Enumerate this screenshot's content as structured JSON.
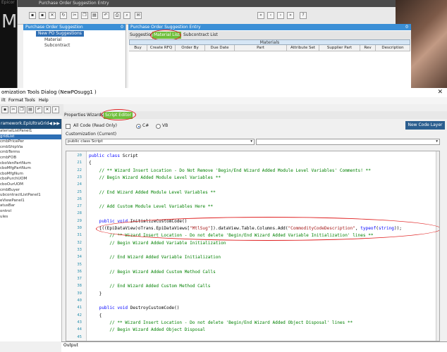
{
  "top_window": {
    "title": "Purchase Order Suggestion Entry",
    "left_title_fragment": "Epicor",
    "left_letter": "M",
    "nav_panel": {
      "header": "Purchase Order Suggestion",
      "header_count": "0",
      "selected": "New PO Suggestions",
      "items": [
        "Material",
        "Subcontract"
      ]
    },
    "right_panel": {
      "header": "Purchase Order Suggestion Entry",
      "header_count": "0",
      "tabs": [
        "Suggestion",
        "Material List",
        "Subcontract List"
      ],
      "active_tab": 1,
      "grid_title": "Materials",
      "columns": [
        "Buy",
        "Create RFQ",
        "Order By",
        "Due Date",
        "Part",
        "Attribute Set",
        "Supplier Part",
        "Rev",
        "Description"
      ]
    }
  },
  "dialog": {
    "title": "omization Tools Dialog  (NewPOsugg1 )",
    "close_glyph": "✕",
    "menu": [
      "ilt",
      "Format",
      "Tools",
      "Help"
    ],
    "left_list": {
      "header": "ramework.EpiUltraGrid",
      "items": [
        "aterialListPanel1",
        "gridList",
        "cmbPricePer",
        "cmbShipVia",
        "cmbTerms",
        "cmbFOB",
        "cboVenPartNum",
        "cboMfgPartNum",
        "cboMfgNum",
        "cboPurchUOM",
        "cboOurUOM",
        "cmbBuyer",
        "ubcontractListPanel1",
        "eViewPanel1",
        "atusBar",
        "ontrol",
        "ules"
      ],
      "selected_index": 1
    },
    "tabs": [
      "Properties",
      "Wizards",
      "Script Editor"
    ],
    "active_tab": 2,
    "all_code_label": "All Code (Read Only)",
    "lang_options": [
      "C#",
      "VB"
    ],
    "customization_label": "Customization (Current)",
    "class_dropdown": "public class Script",
    "new_code_layer_button": "New Code Layer",
    "output_label": "Output"
  },
  "code_lines": [
    {
      "n": "20",
      "parts": [
        [
          "kw",
          "public class "
        ],
        [
          "",
          "Script"
        ]
      ]
    },
    {
      "n": "21",
      "parts": [
        [
          "",
          "{"
        ]
      ]
    },
    {
      "n": "22",
      "parts": [
        [
          "cm",
          "    // ** Wizard Insert Location - Do Not Remove 'Begin/End Wizard Added Module Level Variables' Comments! **"
        ]
      ]
    },
    {
      "n": "23",
      "parts": [
        [
          "cm",
          "    // Begin Wizard Added Module Level Variables **"
        ]
      ]
    },
    {
      "n": "24",
      "parts": [
        [
          "",
          ""
        ]
      ]
    },
    {
      "n": "25",
      "parts": [
        [
          "cm",
          "    // End Wizard Added Module Level Variables **"
        ]
      ]
    },
    {
      "n": "26",
      "parts": [
        [
          "",
          ""
        ]
      ]
    },
    {
      "n": "27",
      "parts": [
        [
          "cm",
          "    // Add Custom Module Level Variables Here **"
        ]
      ]
    },
    {
      "n": "28",
      "parts": [
        [
          "",
          ""
        ]
      ]
    },
    {
      "n": "29",
      "parts": [
        [
          "kw",
          "    public void "
        ],
        [
          "",
          "InitializeCustomCode()"
        ]
      ]
    },
    {
      "n": "30",
      "parts": [
        [
          "",
          "    {((EpiDataView)oTrans.EpiDataViews["
        ],
        [
          "st",
          "\"MtlSug\""
        ],
        [
          "",
          "]).dataView.Table.Columns.Add("
        ],
        [
          "st",
          "\"CommodityCodeDescription\""
        ],
        [
          "",
          ", "
        ],
        [
          "kw",
          "typeof"
        ],
        [
          "",
          "("
        ],
        [
          "kw",
          "string"
        ],
        [
          "",
          "));"
        ]
      ]
    },
    {
      "n": "31",
      "parts": [
        [
          "cm",
          "        // ** Wizard Insert Location - Do not delete 'Begin/End Wizard Added Variable Initialization' lines **"
        ]
      ]
    },
    {
      "n": "32",
      "parts": [
        [
          "cm",
          "        // Begin Wizard Added Variable Initialization"
        ]
      ]
    },
    {
      "n": "33",
      "parts": [
        [
          "",
          ""
        ]
      ]
    },
    {
      "n": "34",
      "parts": [
        [
          "cm",
          "        // End Wizard Added Variable Initialization"
        ]
      ]
    },
    {
      "n": "35",
      "parts": [
        [
          "",
          ""
        ]
      ]
    },
    {
      "n": "36",
      "parts": [
        [
          "cm",
          "        // Begin Wizard Added Custom Method Calls"
        ]
      ]
    },
    {
      "n": "37",
      "parts": [
        [
          "",
          ""
        ]
      ]
    },
    {
      "n": "38",
      "parts": [
        [
          "cm",
          "        // End Wizard Added Custom Method Calls"
        ]
      ]
    },
    {
      "n": "39",
      "parts": [
        [
          "",
          "    }"
        ]
      ]
    },
    {
      "n": "40",
      "parts": [
        [
          "",
          ""
        ]
      ]
    },
    {
      "n": "41",
      "parts": [
        [
          "kw",
          "    public void "
        ],
        [
          "",
          "DestroyCustomCode()"
        ]
      ]
    },
    {
      "n": "42",
      "parts": [
        [
          "",
          "    {"
        ]
      ]
    },
    {
      "n": "43",
      "parts": [
        [
          "cm",
          "        // ** Wizard Insert Location - Do not delete 'Begin/End Wizard Added Object Disposal' lines **"
        ]
      ]
    },
    {
      "n": "44",
      "parts": [
        [
          "cm",
          "        // Begin Wizard Added Object Disposal"
        ]
      ]
    },
    {
      "n": "45",
      "parts": [
        [
          "",
          ""
        ]
      ]
    },
    {
      "n": "46",
      "parts": [
        [
          "cm",
          "        // End Wizard Added Object Disposal"
        ]
      ]
    },
    {
      "n": "47",
      "parts": [
        [
          "",
          ""
        ]
      ]
    },
    {
      "n": "48",
      "parts": [
        [
          "cm",
          "        // Begin Custom Code Disposal"
        ]
      ]
    },
    {
      "n": "49",
      "parts": [
        [
          "",
          ""
        ]
      ]
    }
  ],
  "colors": {
    "accent": "#3b8fd6",
    "active_tab": "#6fbf3b",
    "highlight_circle": "#e02020"
  }
}
